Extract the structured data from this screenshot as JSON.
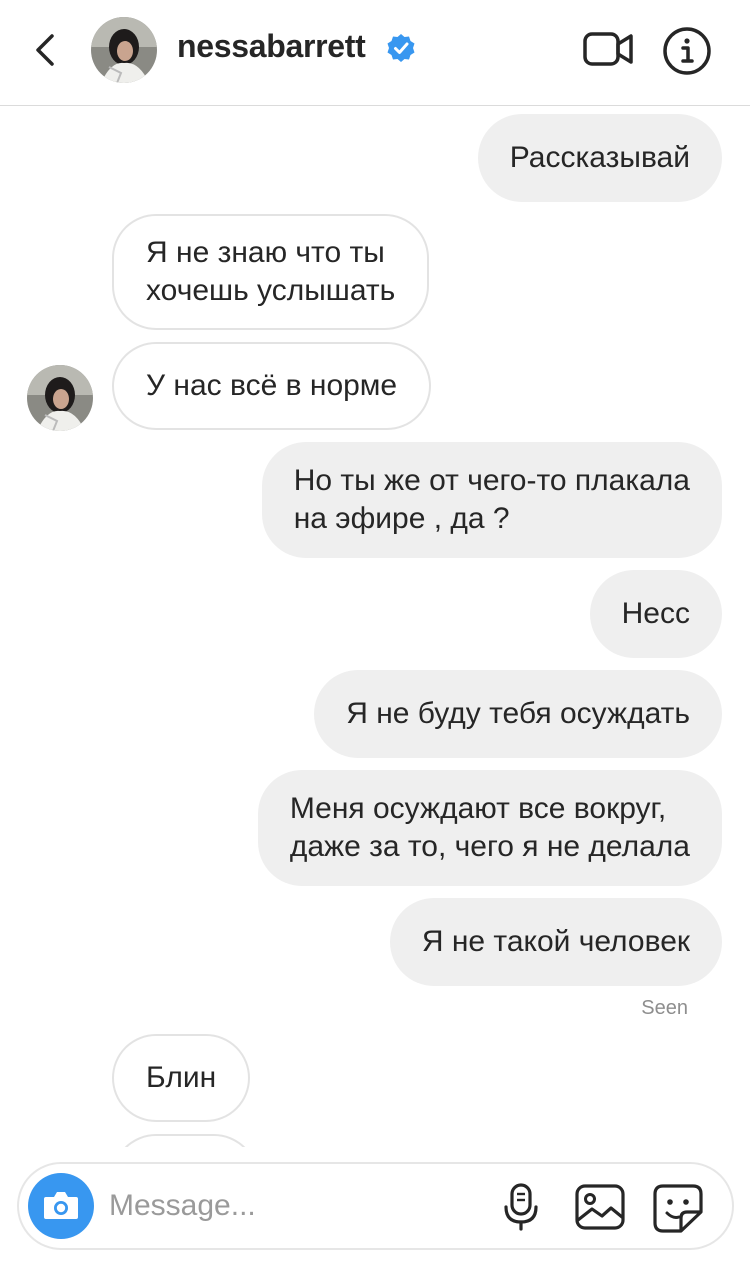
{
  "header": {
    "username": "nessabarrett",
    "verified": true
  },
  "messages": [
    {
      "side": "out",
      "lines": [
        "Рассказывай"
      ]
    },
    {
      "side": "in",
      "lines": [
        "Я не знаю что ты",
        "хочешь услышать"
      ]
    },
    {
      "side": "in",
      "lines": [
        "У нас всё в норме"
      ],
      "avatar": true
    },
    {
      "side": "out",
      "lines": [
        "Но ты же от чего-то плакала",
        "на эфире , да ?"
      ]
    },
    {
      "side": "out",
      "lines": [
        "Несс"
      ]
    },
    {
      "side": "out",
      "lines": [
        "Я не буду тебя осуждать"
      ]
    },
    {
      "side": "out",
      "lines": [
        "Меня осуждают все вокруг,",
        "даже за то, чего я не делала"
      ]
    },
    {
      "side": "out",
      "lines": [
        "Я не такой человек"
      ]
    },
    {
      "side": "in",
      "lines": [
        "Блин"
      ]
    }
  ],
  "seen_label": "Seen",
  "composer": {
    "placeholder": "Message..."
  },
  "icons": {
    "back": "chevron-left-icon",
    "verified": "verified-badge-icon",
    "video": "video-camera-icon",
    "info": "info-icon",
    "camera": "camera-icon",
    "mic": "microphone-icon",
    "gallery": "image-icon",
    "sticker": "sticker-icon"
  },
  "colors": {
    "accent": "#3897f0",
    "outgoing_bubble": "#efefef",
    "incoming_border": "#e3e3e3",
    "text": "#262626",
    "muted": "#8e8e8e"
  }
}
